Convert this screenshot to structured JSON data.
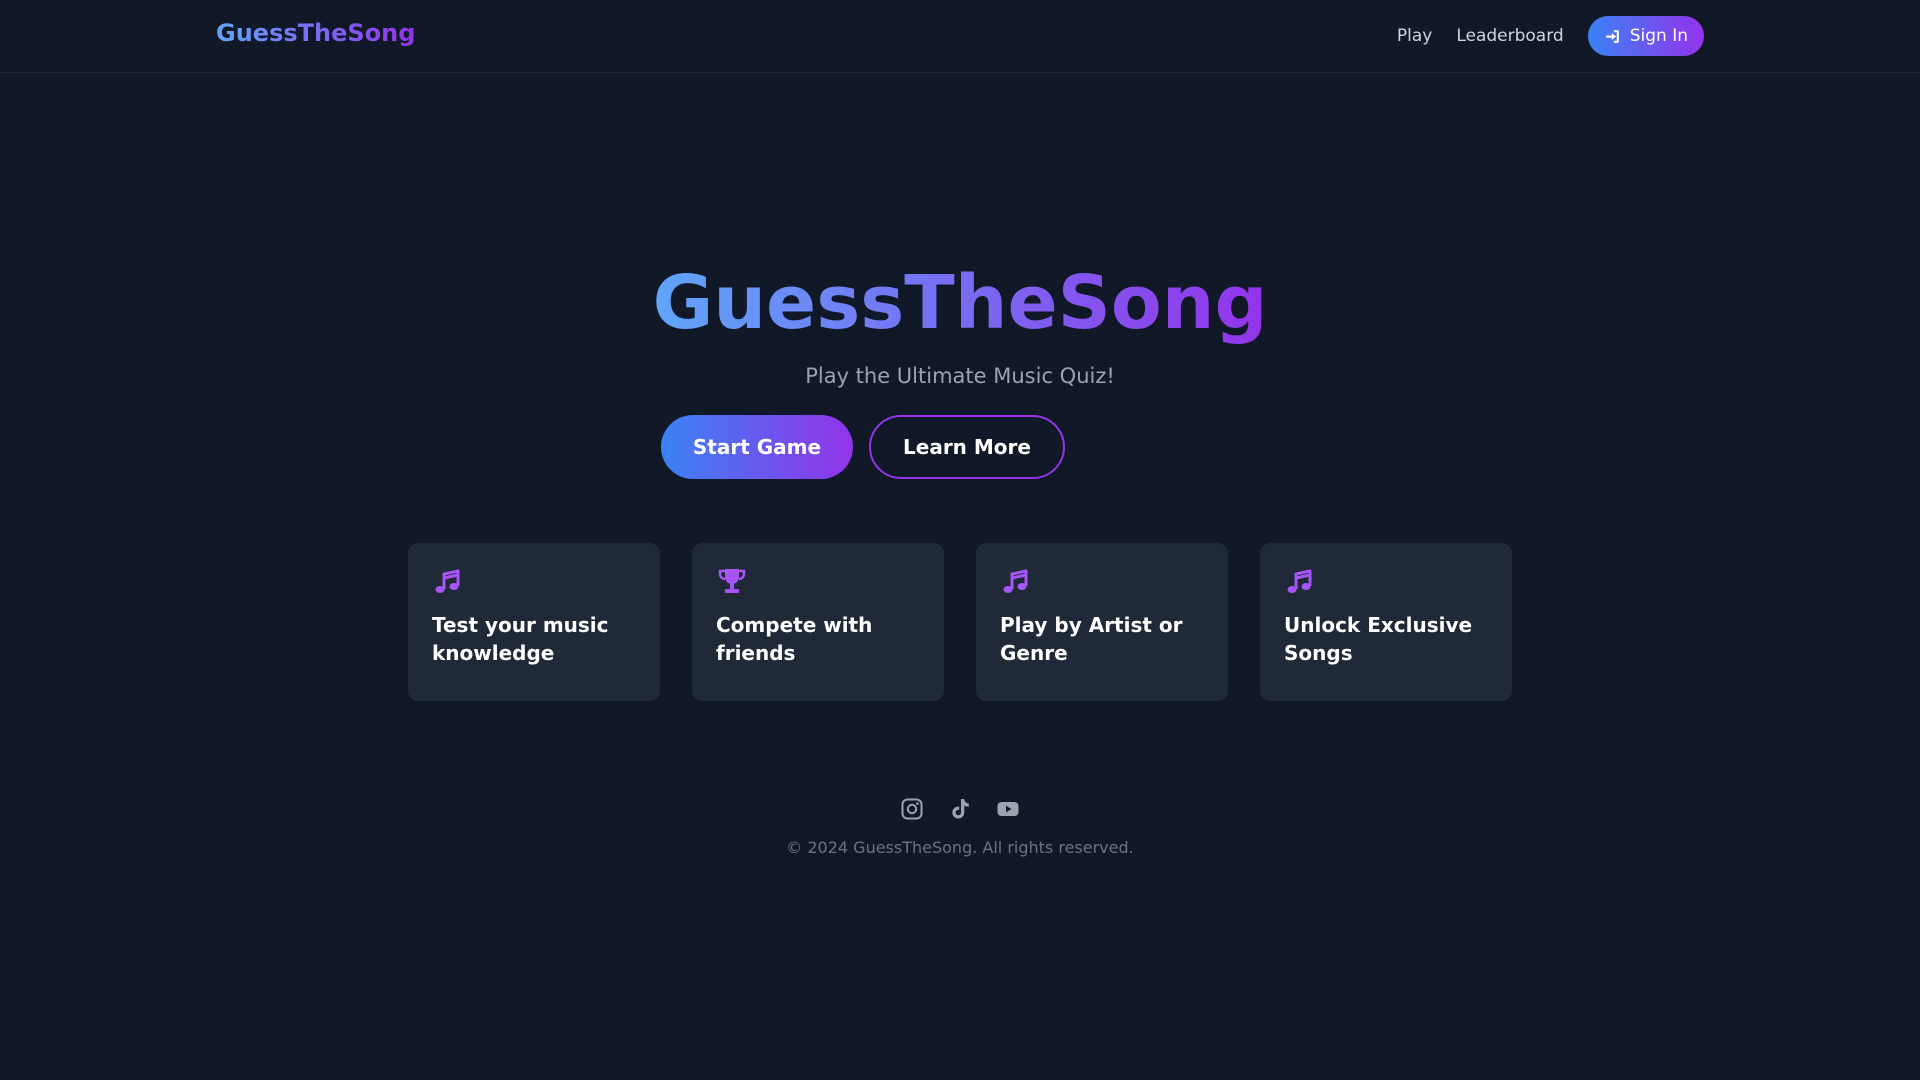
{
  "nav": {
    "brand": "GuessTheSong",
    "links": [
      "Play",
      "Leaderboard"
    ],
    "sign_in_label": "Sign In",
    "sign_in_icon": "sign-in-icon"
  },
  "hero": {
    "title": "GuessTheSong",
    "subtitle": "Play the Ultimate Music Quiz!",
    "start_label": "Start Game",
    "learn_label": "Learn More"
  },
  "features": [
    {
      "icon": "music-note-icon",
      "title": "Test your music knowledge"
    },
    {
      "icon": "trophy-icon",
      "title": "Compete with friends"
    },
    {
      "icon": "music-note-icon",
      "title": "Play by Artist or Genre"
    },
    {
      "icon": "music-note-icon",
      "title": "Unlock Exclusive Songs"
    }
  ],
  "footer": {
    "socials": [
      "instagram-icon",
      "tiktok-icon",
      "youtube-icon"
    ],
    "copyright": "© 2024 GuessTheSong. All rights reserved."
  },
  "colors": {
    "background": "#111827",
    "card": "#1f2937",
    "accent_start": "#3b82f6",
    "accent_end": "#9333ea",
    "icon_accent": "#a855f7",
    "muted_text": "#9ca3af",
    "footer_text": "#6b7280"
  }
}
